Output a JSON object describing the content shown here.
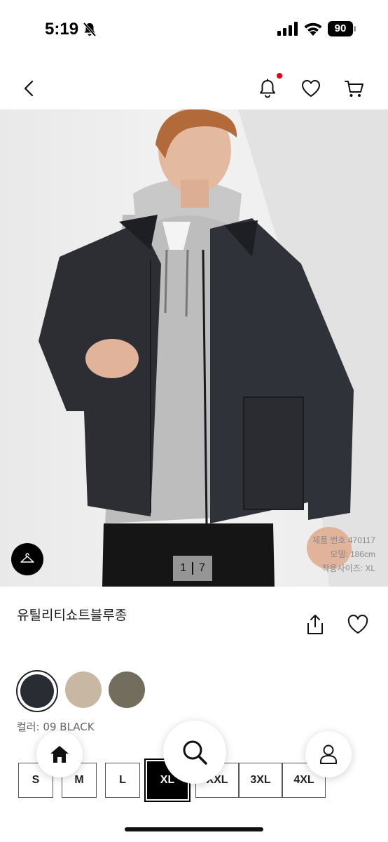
{
  "status_bar": {
    "time": "5:19",
    "battery": "90"
  },
  "header": {
    "icons": [
      "chevron-left-icon",
      "bell-icon",
      "heart-icon",
      "cart-icon"
    ],
    "notification_dot_color": "#e60012"
  },
  "hero": {
    "page_current": "1",
    "page_total": "7",
    "model_info": {
      "product_number": "제품 번호 470117",
      "model_height": "모델: 186cm",
      "size_worn": "착용사이즈: XL"
    },
    "fit_icon": "hanger-icon"
  },
  "product": {
    "title": "유틸리티쇼트블루종",
    "actions": [
      "share-icon",
      "heart-icon"
    ]
  },
  "colors": {
    "swatches": [
      {
        "name": "09 BLACK",
        "hex": "#2a2c33",
        "selected": true
      },
      {
        "name": "",
        "hex": "#c7b7a3",
        "selected": false
      },
      {
        "name": "",
        "hex": "#736d5e",
        "selected": false
      }
    ],
    "label": "컬러: 09 BLACK"
  },
  "sizes": {
    "options": [
      "S",
      "M",
      "L",
      "XL",
      "XXL",
      "3XL",
      "4XL"
    ],
    "selected": "XL"
  },
  "bottom_nav": {
    "items": [
      "home-icon",
      "search-icon",
      "user-icon"
    ]
  }
}
